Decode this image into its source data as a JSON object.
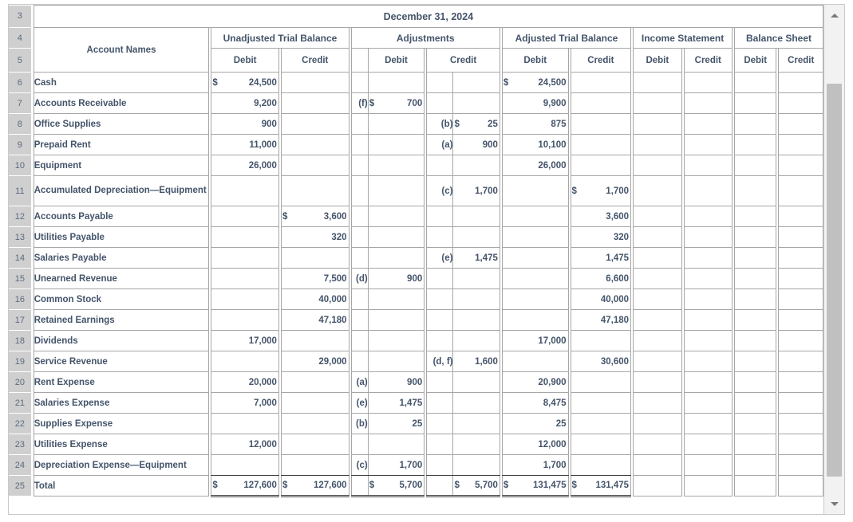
{
  "worksheet": {
    "title": "December 31, 2024",
    "account_names_header": "Account Names",
    "row_numbers": [
      "3",
      "4",
      "5",
      "6",
      "7",
      "8",
      "9",
      "10",
      "11",
      "12",
      "13",
      "14",
      "15",
      "16",
      "17",
      "18",
      "19",
      "20",
      "21",
      "22",
      "23",
      "24",
      "25"
    ],
    "column_groups": [
      {
        "id": "unadjusted",
        "label": "Unadjusted Trial Balance"
      },
      {
        "id": "adjustments",
        "label": "Adjustments"
      },
      {
        "id": "adjusted",
        "label": "Adjusted Trial Balance"
      },
      {
        "id": "income",
        "label": "Income Statement"
      },
      {
        "id": "balance",
        "label": "Balance Sheet"
      }
    ],
    "sub_headers": {
      "debit": "Debit",
      "credit": "Credit"
    },
    "rows": [
      {
        "n": "6",
        "account": "Cash",
        "utb_d_cur": "$",
        "utb_d": "24,500",
        "utb_c_cur": "",
        "utb_c": "",
        "adj_d_ref": "",
        "adj_d_cur": "",
        "adj_d": "",
        "adj_c_ref": "",
        "adj_c_cur": "",
        "adj_c": "",
        "atb_d_cur": "$",
        "atb_d": "24,500",
        "atb_c_cur": "",
        "atb_c": "",
        "is_d": "",
        "is_c": "",
        "bs_d": "",
        "bs_c": ""
      },
      {
        "n": "7",
        "account": "Accounts Receivable",
        "utb_d_cur": "",
        "utb_d": "9,200",
        "utb_c_cur": "",
        "utb_c": "",
        "adj_d_ref": "(f)",
        "adj_d_cur": "$",
        "adj_d": "700",
        "adj_c_ref": "",
        "adj_c_cur": "",
        "adj_c": "",
        "atb_d_cur": "",
        "atb_d": "9,900",
        "atb_c_cur": "",
        "atb_c": "",
        "is_d": "",
        "is_c": "",
        "bs_d": "",
        "bs_c": ""
      },
      {
        "n": "8",
        "account": "Office Supplies",
        "utb_d_cur": "",
        "utb_d": "900",
        "utb_c_cur": "",
        "utb_c": "",
        "adj_d_ref": "",
        "adj_d_cur": "",
        "adj_d": "",
        "adj_c_ref": "(b)",
        "adj_c_cur": "$",
        "adj_c": "25",
        "atb_d_cur": "",
        "atb_d": "875",
        "atb_c_cur": "",
        "atb_c": "",
        "is_d": "",
        "is_c": "",
        "bs_d": "",
        "bs_c": ""
      },
      {
        "n": "9",
        "account": "Prepaid Rent",
        "utb_d_cur": "",
        "utb_d": "11,000",
        "utb_c_cur": "",
        "utb_c": "",
        "adj_d_ref": "",
        "adj_d_cur": "",
        "adj_d": "",
        "adj_c_ref": "(a)",
        "adj_c_cur": "",
        "adj_c": "900",
        "atb_d_cur": "",
        "atb_d": "10,100",
        "atb_c_cur": "",
        "atb_c": "",
        "is_d": "",
        "is_c": "",
        "bs_d": "",
        "bs_c": ""
      },
      {
        "n": "10",
        "account": "Equipment",
        "utb_d_cur": "",
        "utb_d": "26,000",
        "utb_c_cur": "",
        "utb_c": "",
        "adj_d_ref": "",
        "adj_d_cur": "",
        "adj_d": "",
        "adj_c_ref": "",
        "adj_c_cur": "",
        "adj_c": "",
        "atb_d_cur": "",
        "atb_d": "26,000",
        "atb_c_cur": "",
        "atb_c": "",
        "is_d": "",
        "is_c": "",
        "bs_d": "",
        "bs_c": ""
      },
      {
        "n": "11",
        "account": "Accumulated Depreciation—Equipment",
        "utb_d_cur": "",
        "utb_d": "",
        "utb_c_cur": "",
        "utb_c": "",
        "adj_d_ref": "",
        "adj_d_cur": "",
        "adj_d": "",
        "adj_c_ref": "(c)",
        "adj_c_cur": "",
        "adj_c": "1,700",
        "atb_d_cur": "",
        "atb_d": "",
        "atb_c_cur": "$",
        "atb_c": "1,700",
        "is_d": "",
        "is_c": "",
        "bs_d": "",
        "bs_c": ""
      },
      {
        "n": "12",
        "account": "Accounts Payable",
        "utb_d_cur": "",
        "utb_d": "",
        "utb_c_cur": "$",
        "utb_c": "3,600",
        "adj_d_ref": "",
        "adj_d_cur": "",
        "adj_d": "",
        "adj_c_ref": "",
        "adj_c_cur": "",
        "adj_c": "",
        "atb_d_cur": "",
        "atb_d": "",
        "atb_c_cur": "",
        "atb_c": "3,600",
        "is_d": "",
        "is_c": "",
        "bs_d": "",
        "bs_c": ""
      },
      {
        "n": "13",
        "account": "Utilities Payable",
        "utb_d_cur": "",
        "utb_d": "",
        "utb_c_cur": "",
        "utb_c": "320",
        "adj_d_ref": "",
        "adj_d_cur": "",
        "adj_d": "",
        "adj_c_ref": "",
        "adj_c_cur": "",
        "adj_c": "",
        "atb_d_cur": "",
        "atb_d": "",
        "atb_c_cur": "",
        "atb_c": "320",
        "is_d": "",
        "is_c": "",
        "bs_d": "",
        "bs_c": ""
      },
      {
        "n": "14",
        "account": "Salaries Payable",
        "utb_d_cur": "",
        "utb_d": "",
        "utb_c_cur": "",
        "utb_c": "",
        "adj_d_ref": "",
        "adj_d_cur": "",
        "adj_d": "",
        "adj_c_ref": "(e)",
        "adj_c_cur": "",
        "adj_c": "1,475",
        "atb_d_cur": "",
        "atb_d": "",
        "atb_c_cur": "",
        "atb_c": "1,475",
        "is_d": "",
        "is_c": "",
        "bs_d": "",
        "bs_c": ""
      },
      {
        "n": "15",
        "account": "Unearned Revenue",
        "utb_d_cur": "",
        "utb_d": "",
        "utb_c_cur": "",
        "utb_c": "7,500",
        "adj_d_ref": "(d)",
        "adj_d_cur": "",
        "adj_d": "900",
        "adj_c_ref": "",
        "adj_c_cur": "",
        "adj_c": "",
        "atb_d_cur": "",
        "atb_d": "",
        "atb_c_cur": "",
        "atb_c": "6,600",
        "is_d": "",
        "is_c": "",
        "bs_d": "",
        "bs_c": ""
      },
      {
        "n": "16",
        "account": "Common Stock",
        "utb_d_cur": "",
        "utb_d": "",
        "utb_c_cur": "",
        "utb_c": "40,000",
        "adj_d_ref": "",
        "adj_d_cur": "",
        "adj_d": "",
        "adj_c_ref": "",
        "adj_c_cur": "",
        "adj_c": "",
        "atb_d_cur": "",
        "atb_d": "",
        "atb_c_cur": "",
        "atb_c": "40,000",
        "is_d": "",
        "is_c": "",
        "bs_d": "",
        "bs_c": ""
      },
      {
        "n": "17",
        "account": "Retained Earnings",
        "utb_d_cur": "",
        "utb_d": "",
        "utb_c_cur": "",
        "utb_c": "47,180",
        "adj_d_ref": "",
        "adj_d_cur": "",
        "adj_d": "",
        "adj_c_ref": "",
        "adj_c_cur": "",
        "adj_c": "",
        "atb_d_cur": "",
        "atb_d": "",
        "atb_c_cur": "",
        "atb_c": "47,180",
        "is_d": "",
        "is_c": "",
        "bs_d": "",
        "bs_c": ""
      },
      {
        "n": "18",
        "account": "Dividends",
        "utb_d_cur": "",
        "utb_d": "17,000",
        "utb_c_cur": "",
        "utb_c": "",
        "adj_d_ref": "",
        "adj_d_cur": "",
        "adj_d": "",
        "adj_c_ref": "",
        "adj_c_cur": "",
        "adj_c": "",
        "atb_d_cur": "",
        "atb_d": "17,000",
        "atb_c_cur": "",
        "atb_c": "",
        "is_d": "",
        "is_c": "",
        "bs_d": "",
        "bs_c": ""
      },
      {
        "n": "19",
        "account": "Service Revenue",
        "utb_d_cur": "",
        "utb_d": "",
        "utb_c_cur": "",
        "utb_c": "29,000",
        "adj_d_ref": "",
        "adj_d_cur": "",
        "adj_d": "",
        "adj_c_ref": "(d, f)",
        "adj_c_cur": "",
        "adj_c": "1,600",
        "atb_d_cur": "",
        "atb_d": "",
        "atb_c_cur": "",
        "atb_c": "30,600",
        "is_d": "",
        "is_c": "",
        "bs_d": "",
        "bs_c": ""
      },
      {
        "n": "20",
        "account": "Rent Expense",
        "utb_d_cur": "",
        "utb_d": "20,000",
        "utb_c_cur": "",
        "utb_c": "",
        "adj_d_ref": "(a)",
        "adj_d_cur": "",
        "adj_d": "900",
        "adj_c_ref": "",
        "adj_c_cur": "",
        "adj_c": "",
        "atb_d_cur": "",
        "atb_d": "20,900",
        "atb_c_cur": "",
        "atb_c": "",
        "is_d": "",
        "is_c": "",
        "bs_d": "",
        "bs_c": ""
      },
      {
        "n": "21",
        "account": "Salaries Expense",
        "utb_d_cur": "",
        "utb_d": "7,000",
        "utb_c_cur": "",
        "utb_c": "",
        "adj_d_ref": "(e)",
        "adj_d_cur": "",
        "adj_d": "1,475",
        "adj_c_ref": "",
        "adj_c_cur": "",
        "adj_c": "",
        "atb_d_cur": "",
        "atb_d": "8,475",
        "atb_c_cur": "",
        "atb_c": "",
        "is_d": "",
        "is_c": "",
        "bs_d": "",
        "bs_c": ""
      },
      {
        "n": "22",
        "account": "Supplies Expense",
        "utb_d_cur": "",
        "utb_d": "",
        "utb_c_cur": "",
        "utb_c": "",
        "adj_d_ref": "(b)",
        "adj_d_cur": "",
        "adj_d": "25",
        "adj_c_ref": "",
        "adj_c_cur": "",
        "adj_c": "",
        "atb_d_cur": "",
        "atb_d": "25",
        "atb_c_cur": "",
        "atb_c": "",
        "is_d": "",
        "is_c": "",
        "bs_d": "",
        "bs_c": ""
      },
      {
        "n": "23",
        "account": "Utilities Expense",
        "utb_d_cur": "",
        "utb_d": "12,000",
        "utb_c_cur": "",
        "utb_c": "",
        "adj_d_ref": "",
        "adj_d_cur": "",
        "adj_d": "",
        "adj_c_ref": "",
        "adj_c_cur": "",
        "adj_c": "",
        "atb_d_cur": "",
        "atb_d": "12,000",
        "atb_c_cur": "",
        "atb_c": "",
        "is_d": "",
        "is_c": "",
        "bs_d": "",
        "bs_c": ""
      },
      {
        "n": "24",
        "account": "Depreciation Expense—Equipment",
        "utb_d_cur": "",
        "utb_d": "",
        "utb_c_cur": "",
        "utb_c": "",
        "adj_d_ref": "(c)",
        "adj_d_cur": "",
        "adj_d": "1,700",
        "adj_c_ref": "",
        "adj_c_cur": "",
        "adj_c": "",
        "atb_d_cur": "",
        "atb_d": "1,700",
        "atb_c_cur": "",
        "atb_c": "",
        "is_d": "",
        "is_c": "",
        "bs_d": "",
        "bs_c": ""
      },
      {
        "n": "25",
        "account": "Total",
        "utb_d_cur": "$",
        "utb_d": "127,600",
        "utb_c_cur": "$",
        "utb_c": "127,600",
        "adj_d_ref": "",
        "adj_d_cur": "$",
        "adj_d": "5,700",
        "adj_c_ref": "",
        "adj_c_cur": "$",
        "adj_c": "5,700",
        "atb_d_cur": "$",
        "atb_d": "131,475",
        "atb_c_cur": "$",
        "atb_c": "131,475",
        "is_d": "",
        "is_c": "",
        "bs_d": "",
        "bs_c": ""
      }
    ]
  },
  "scrollbar": {
    "up_icon": "triangle-up-icon",
    "down_icon": "triangle-down-icon"
  },
  "colors": {
    "text": "#44546a",
    "grid": "#a6a6a6",
    "row_header_bg": "#cfcfcf",
    "rule": "#3b3b3b"
  }
}
